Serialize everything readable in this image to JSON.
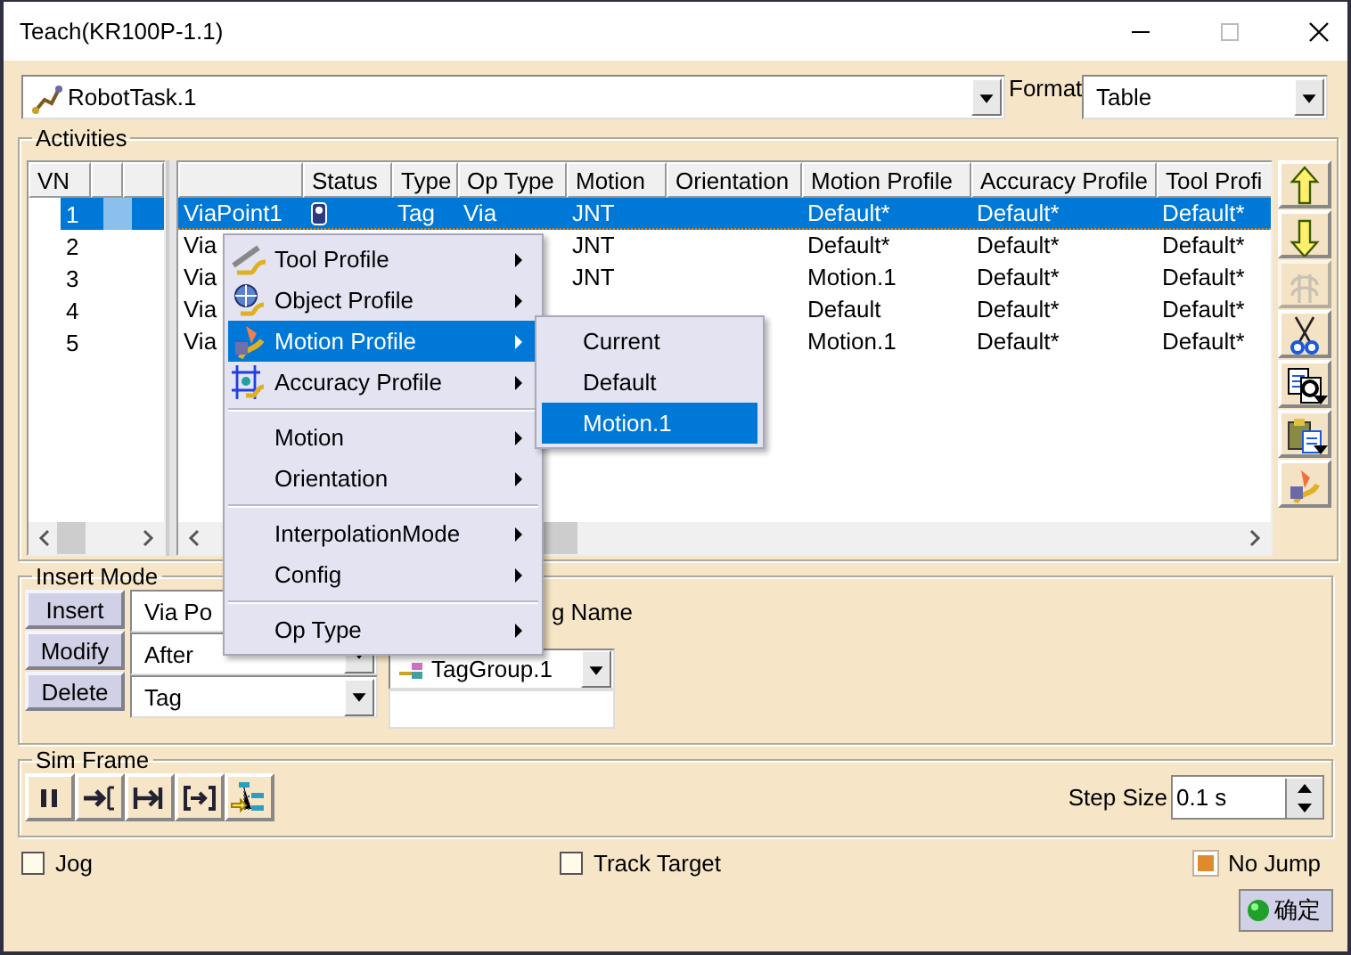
{
  "window": {
    "title": "Teach(KR100P-1.1)"
  },
  "task": {
    "value": "RobotTask.1"
  },
  "format": {
    "label": "Format",
    "value": "Table"
  },
  "activities": {
    "title": "Activities",
    "vn_column": "VN",
    "columns": [
      "",
      "Status",
      "Type",
      "Op Type",
      "Motion",
      "Orientation",
      "Motion Profile",
      "Accuracy Profile",
      "Tool Profi"
    ],
    "rows": [
      {
        "vn": "1",
        "selected": true,
        "status_icon": true,
        "cells": [
          "ViaPoint1",
          "",
          "Tag",
          "Via",
          "JNT",
          "",
          "Default*",
          "Default*",
          "Default*"
        ]
      },
      {
        "vn": "2",
        "selected": false,
        "cells": [
          "Via",
          "",
          "",
          "",
          "JNT",
          "",
          "Default*",
          "Default*",
          "Default*"
        ]
      },
      {
        "vn": "3",
        "selected": false,
        "cells": [
          "Via",
          "",
          "",
          "",
          "JNT",
          "",
          "Motion.1",
          "Default*",
          "Default*"
        ]
      },
      {
        "vn": "4",
        "selected": false,
        "cells": [
          "Via",
          "",
          "",
          "",
          "",
          "",
          "Default",
          "Default*",
          "Default*"
        ]
      },
      {
        "vn": "5",
        "selected": false,
        "cells": [
          "Via",
          "",
          "",
          "",
          "",
          "",
          "Motion.1",
          "Default*",
          "Default*"
        ]
      }
    ],
    "toolbar": [
      {
        "kind": "up",
        "disabled": false,
        "dropdown": false
      },
      {
        "kind": "down",
        "disabled": false,
        "dropdown": false
      },
      {
        "kind": "spring",
        "disabled": true,
        "dropdown": false
      },
      {
        "kind": "cut",
        "disabled": false,
        "dropdown": false
      },
      {
        "kind": "copy",
        "disabled": false,
        "dropdown": true
      },
      {
        "kind": "paste",
        "disabled": false,
        "dropdown": true
      },
      {
        "kind": "motion",
        "disabled": false,
        "dropdown": false
      }
    ]
  },
  "context_menu": {
    "groups": [
      [
        {
          "label": "Tool Profile",
          "kind": "tool",
          "selected": false
        },
        {
          "label": "Object Profile",
          "kind": "object",
          "selected": false
        },
        {
          "label": "Motion Profile",
          "kind": "motion",
          "selected": true
        },
        {
          "label": "Accuracy Profile",
          "kind": "accuracy",
          "selected": false
        }
      ],
      [
        {
          "label": "Motion",
          "kind": "plain",
          "selected": false
        },
        {
          "label": "Orientation",
          "kind": "plain",
          "selected": false
        }
      ],
      [
        {
          "label": "InterpolationMode",
          "kind": "plain",
          "selected": false
        },
        {
          "label": "Config",
          "kind": "plain",
          "selected": false
        }
      ],
      [
        {
          "label": "Op Type",
          "kind": "plain",
          "selected": false
        }
      ]
    ]
  },
  "submenu": {
    "items": [
      {
        "label": "Current",
        "selected": false
      },
      {
        "label": "Default",
        "selected": false
      },
      {
        "label": "Motion.1",
        "selected": true
      }
    ]
  },
  "insert_mode": {
    "title": "Insert Mode",
    "buttons": [
      "Insert",
      "Modify",
      "Delete"
    ],
    "combos": [
      {
        "value": "Via Po",
        "dropdown": false
      },
      {
        "value": "After",
        "dropdown": true
      },
      {
        "value": "Tag",
        "dropdown": true
      }
    ],
    "tag_name_label": "g Name",
    "tag_group": "TagGroup.1"
  },
  "sim_frame": {
    "title": "Sim Frame",
    "buttons": [
      {
        "kind": "pause"
      },
      {
        "kind": "step"
      },
      {
        "kind": "jump"
      },
      {
        "kind": "range"
      },
      {
        "kind": "tree"
      }
    ],
    "step_size": {
      "label": "Step Size",
      "value": "0.1 s"
    }
  },
  "options": [
    {
      "label": "Jog",
      "checked": false
    },
    {
      "label": "Track Target",
      "checked": false
    },
    {
      "label": "No Jump",
      "checked": true
    }
  ],
  "ok_button": "确定"
}
